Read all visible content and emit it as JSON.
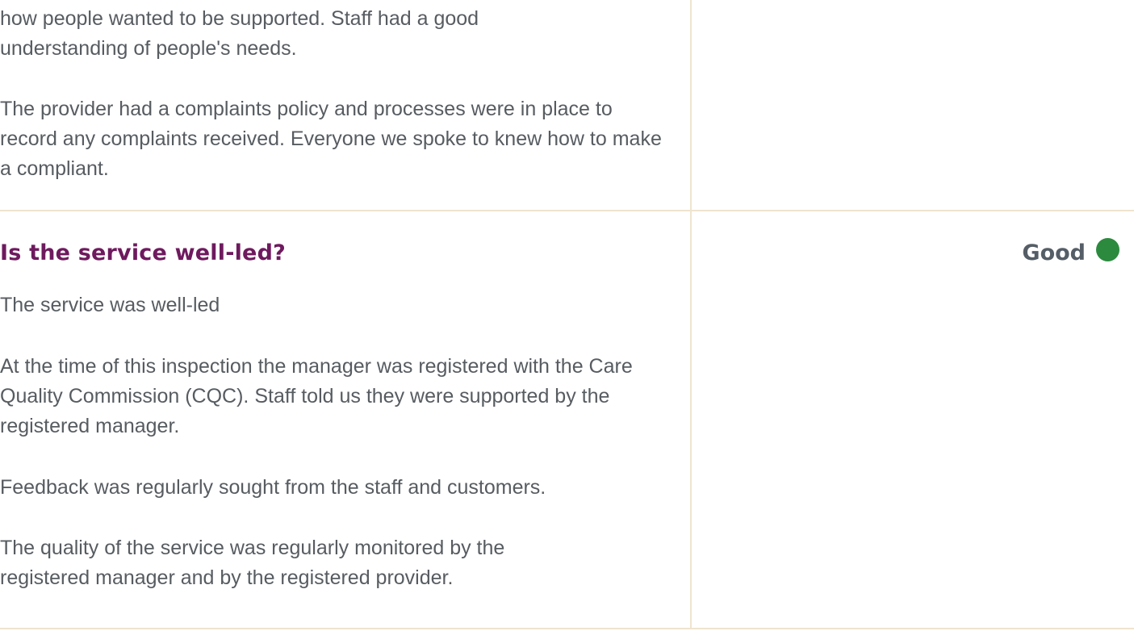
{
  "responsive_section": {
    "paragraphs": [
      "how people wanted to be supported. Staff had a good understanding of people's needs.",
      "The provider had a complaints policy and processes were in place to record any complaints received. Everyone we spoke to knew how to make a compliant."
    ]
  },
  "well_led_section": {
    "heading": "Is the service well-led?",
    "rating_label": "Good",
    "rating_color": "#2b8a3e",
    "paragraphs": [
      "The service was well-led",
      "At the time of this inspection the manager was registered with the Care Quality Commission (CQC). Staff told us they were supported by the registered manager.",
      "Feedback was regularly sought from the staff and customers.",
      "The quality of the service was regularly monitored by the registered manager and by the registered provider."
    ]
  }
}
